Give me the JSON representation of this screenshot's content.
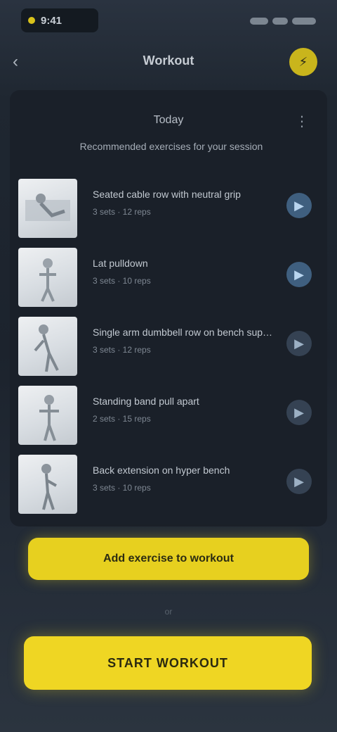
{
  "status_bar": {
    "time": "9:41"
  },
  "header": {
    "title": "Workout",
    "back_icon": "chevron-left-icon",
    "action_icon": "bolt-icon"
  },
  "sheet": {
    "title": "Today",
    "subtitle": "Recommended exercises for your session",
    "more_icon": "more-vertical-icon"
  },
  "exercises": [
    {
      "title": "Seated cable row with neutral grip",
      "subtitle": "3 sets · 12 reps",
      "action_icon": "play-icon"
    },
    {
      "title": "Lat pulldown",
      "subtitle": "3 sets · 10 reps",
      "action_icon": "play-icon"
    },
    {
      "title": "Single arm dumbbell row on bench support",
      "subtitle": "3 sets · 12 reps",
      "action_icon": "play-icon"
    },
    {
      "title": "Standing band pull apart",
      "subtitle": "2 sets · 15 reps",
      "action_icon": "play-icon"
    },
    {
      "title": "Back extension on hyper bench",
      "subtitle": "3 sets · 10 reps",
      "action_icon": "play-icon"
    }
  ],
  "buttons": {
    "primary_label": "Add exercise to workout",
    "divider": "or",
    "secondary_label": "START WORKOUT"
  },
  "colors": {
    "accent": "#e7d01f",
    "background": "#1f2731",
    "sheet": "#1a2029",
    "item_action": "#3f5f7f"
  }
}
